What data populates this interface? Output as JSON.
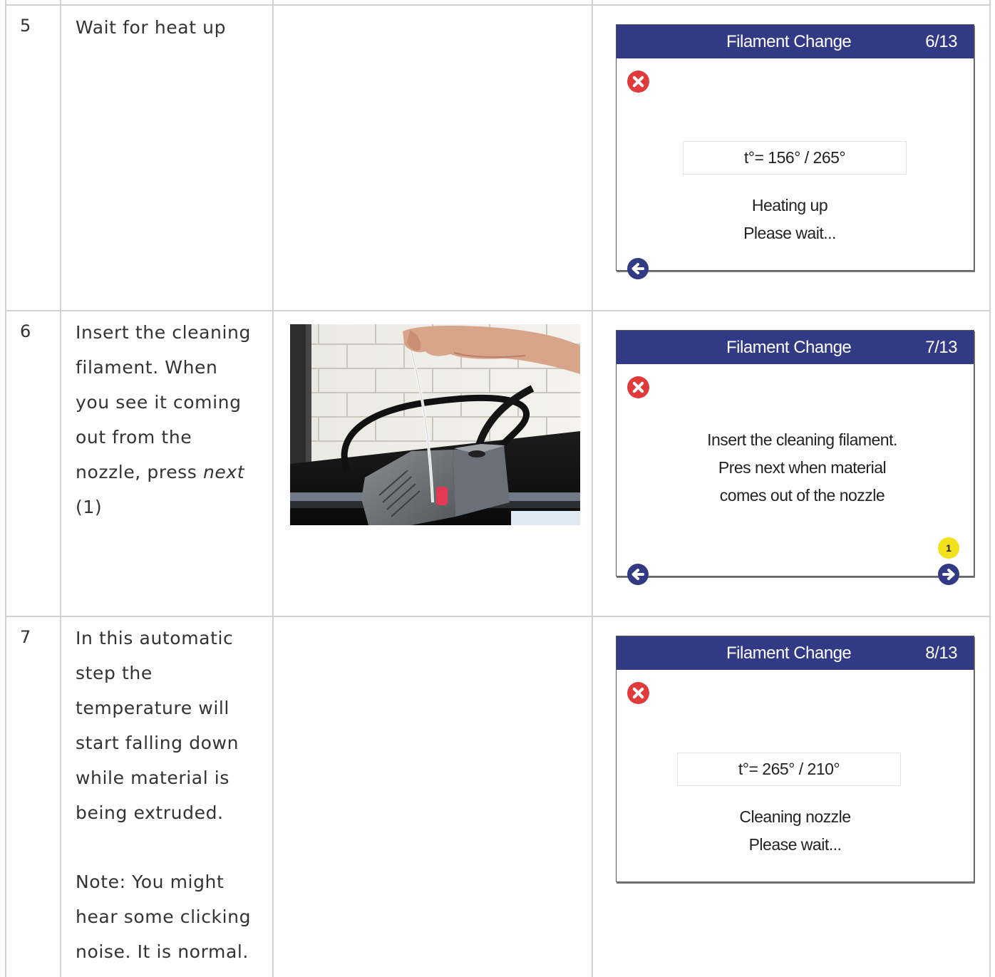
{
  "rows": [
    {
      "number": "5",
      "description": [
        "Wait for heat up"
      ],
      "screen": {
        "title": "Filament Change",
        "step": "6/13",
        "temperature": "t°= 156° / 265°",
        "message_lines": [
          "Heating up",
          "Please wait..."
        ]
      }
    },
    {
      "number": "6",
      "description_lines": [
        "Insert the cleaning",
        "filament. When",
        "you see it coming",
        "out from the",
        "nozzle, press ",
        "(1)"
      ],
      "description_emphasis": "next",
      "screen": {
        "title": "Filament Change",
        "step": "7/13",
        "message_lines": [
          "Insert the cleaning filament.",
          "Pres next when material",
          "comes out of the nozzle"
        ],
        "badge": "1"
      }
    },
    {
      "number": "7",
      "description_lines": [
        "In this automatic",
        "step the",
        "temperature will",
        "start falling down",
        "while material is",
        "being extruded."
      ],
      "note_lines": [
        "Note: You might",
        "hear some clicking",
        "noise. It is normal."
      ],
      "screen": {
        "title": "Filament Change",
        "step": "8/13",
        "temperature": "t°= 265° / 210°",
        "message_lines": [
          "Cleaning nozzle",
          "Please wait..."
        ]
      }
    }
  ],
  "colors": {
    "screen_header": "#333a85",
    "close_icon": "#e03a3a",
    "nav_icon": "#333a85",
    "badge": "#f2e11a",
    "grid_lines": "#d2d2d2"
  },
  "icons": {
    "close": "close-circle-icon",
    "back": "back-arrow-icon",
    "next": "next-arrow-icon"
  }
}
